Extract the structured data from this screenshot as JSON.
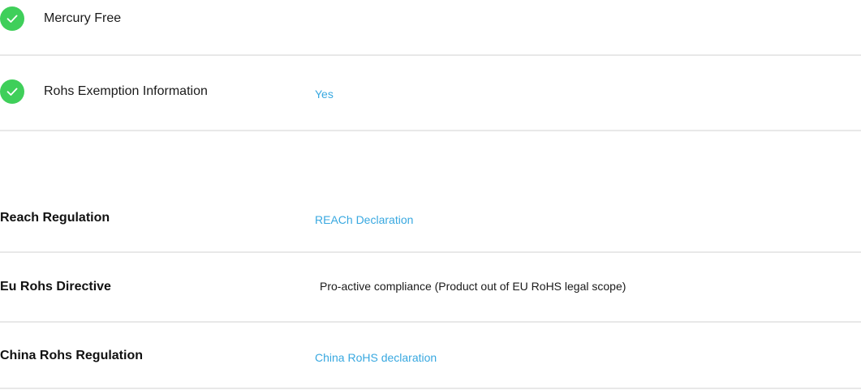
{
  "checklist": [
    {
      "label": "Mercury Free",
      "value": "",
      "icon": "check-circle-icon",
      "icon_color": "#3fcf5a"
    },
    {
      "label": "Rohs Exemption Information",
      "value": "Yes",
      "icon": "check-circle-icon",
      "icon_color": "#3fcf5a"
    }
  ],
  "regulations": [
    {
      "label": "Reach Regulation",
      "value": "REACh Declaration",
      "is_link": true
    },
    {
      "label": "Eu Rohs Directive",
      "value": "Pro-active compliance (Product out of EU RoHS legal scope)",
      "is_link": false
    },
    {
      "label": "China Rohs Regulation",
      "value": "China RoHS declaration",
      "is_link": true
    }
  ],
  "colors": {
    "link": "#38a8e0",
    "check": "#3fcf5a",
    "divider": "#e8e8e8",
    "text": "#1a1a1a"
  }
}
